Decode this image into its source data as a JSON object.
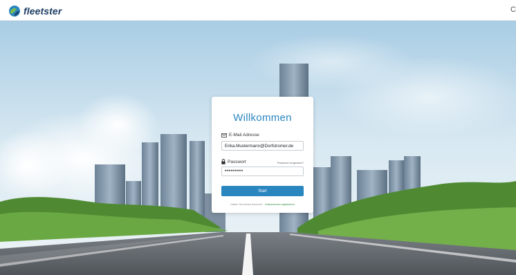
{
  "app": {
    "logo_text": "fleetster",
    "topbar_right_glyph": "C"
  },
  "login": {
    "title": "Willkommen",
    "email_label": "E-Mail Adresse",
    "email_icon": "envelope-icon",
    "email_value": "Erika.Mustermann@Dorfstromer.de",
    "password_label": "Passwort",
    "password_icon": "lock-icon",
    "forgot_password": "Passwort vergessen?",
    "password_value": "*********",
    "start_button": "Start",
    "register_prompt": "Haben Sie keinen Account?",
    "register_link": "Unternehmen registrieren"
  },
  "colors": {
    "accent": "#2a86bf",
    "brand_dark": "#1f3f66",
    "link_green": "#2f8a3a"
  }
}
